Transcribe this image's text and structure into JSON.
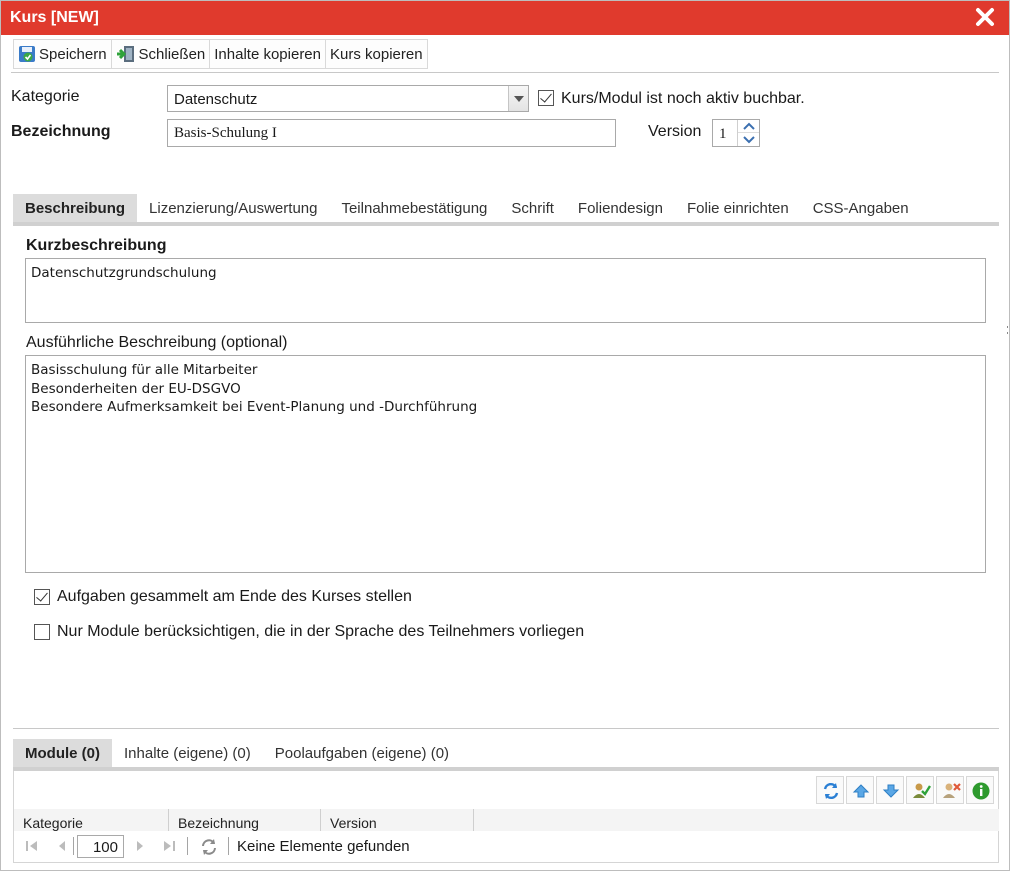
{
  "window": {
    "title": "Kurs [NEW]"
  },
  "toolbar": {
    "save_label": "Speichern",
    "close_label": "Schließen",
    "copy_contents_label": "Inhalte kopieren",
    "copy_course_label": "Kurs kopieren"
  },
  "form": {
    "category_label": "Kategorie",
    "category_value": "Datenschutz",
    "active_label": "Kurs/Modul ist noch aktiv buchbar.",
    "active_checked": true,
    "name_label": "Bezeichnung",
    "name_value": "Basis-Schulung I",
    "version_label": "Version",
    "version_value": "1"
  },
  "tabs": [
    {
      "label": "Beschreibung",
      "active": true
    },
    {
      "label": "Lizenzierung/Auswertung",
      "active": false
    },
    {
      "label": "Teilnahmebestätigung",
      "active": false
    },
    {
      "label": "Schrift",
      "active": false
    },
    {
      "label": "Foliendesign",
      "active": false
    },
    {
      "label": "Folie einrichten",
      "active": false
    },
    {
      "label": "CSS-Angaben",
      "active": false
    }
  ],
  "description": {
    "short_label": "Kurzbeschreibung",
    "short_value": "Datenschutzgrundschulung",
    "long_label": "Ausführliche Beschreibung (optional)",
    "long_value": "Basisschulung für alle Mitarbeiter\nBesonderheiten der EU-DSGVO\nBesondere Aufmerksamkeit bei Event-Planung und -Durchführung",
    "option1_label": "Aufgaben gesammelt am Ende des Kurses stellen",
    "option1_checked": true,
    "option2_label": "Nur Module berücksichtigen, die in der Sprache des Teilnehmers vorliegen",
    "option2_checked": false
  },
  "bottom_tabs": [
    {
      "label": "Module (0)",
      "active": true
    },
    {
      "label": "Inhalte (eigene) (0)",
      "active": false
    },
    {
      "label": "Poolaufgaben (eigene) (0)",
      "active": false
    }
  ],
  "grid": {
    "tool_icons": [
      "refresh-icon",
      "move-up-icon",
      "move-down-icon",
      "user-edit-icon",
      "user-remove-icon",
      "info-icon"
    ],
    "columns": [
      "Kategorie",
      "Bezeichnung",
      "Version"
    ],
    "page_size": "100",
    "empty_text": "Keine Elemente gefunden"
  },
  "colors": {
    "titlebar": "#e03a2d",
    "tab_active": "#dcdcdc"
  }
}
